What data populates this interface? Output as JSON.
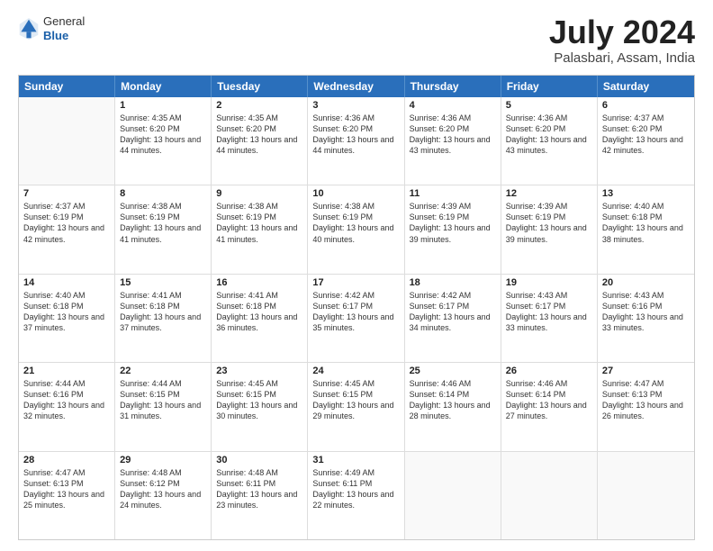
{
  "logo": {
    "general": "General",
    "blue": "Blue"
  },
  "title": "July 2024",
  "location": "Palasbari, Assam, India",
  "header_days": [
    "Sunday",
    "Monday",
    "Tuesday",
    "Wednesday",
    "Thursday",
    "Friday",
    "Saturday"
  ],
  "weeks": [
    [
      {
        "day": "",
        "sunrise": "",
        "sunset": "",
        "daylight": ""
      },
      {
        "day": "1",
        "sunrise": "Sunrise: 4:35 AM",
        "sunset": "Sunset: 6:20 PM",
        "daylight": "Daylight: 13 hours and 44 minutes."
      },
      {
        "day": "2",
        "sunrise": "Sunrise: 4:35 AM",
        "sunset": "Sunset: 6:20 PM",
        "daylight": "Daylight: 13 hours and 44 minutes."
      },
      {
        "day": "3",
        "sunrise": "Sunrise: 4:36 AM",
        "sunset": "Sunset: 6:20 PM",
        "daylight": "Daylight: 13 hours and 44 minutes."
      },
      {
        "day": "4",
        "sunrise": "Sunrise: 4:36 AM",
        "sunset": "Sunset: 6:20 PM",
        "daylight": "Daylight: 13 hours and 43 minutes."
      },
      {
        "day": "5",
        "sunrise": "Sunrise: 4:36 AM",
        "sunset": "Sunset: 6:20 PM",
        "daylight": "Daylight: 13 hours and 43 minutes."
      },
      {
        "day": "6",
        "sunrise": "Sunrise: 4:37 AM",
        "sunset": "Sunset: 6:20 PM",
        "daylight": "Daylight: 13 hours and 42 minutes."
      }
    ],
    [
      {
        "day": "7",
        "sunrise": "Sunrise: 4:37 AM",
        "sunset": "Sunset: 6:19 PM",
        "daylight": "Daylight: 13 hours and 42 minutes."
      },
      {
        "day": "8",
        "sunrise": "Sunrise: 4:38 AM",
        "sunset": "Sunset: 6:19 PM",
        "daylight": "Daylight: 13 hours and 41 minutes."
      },
      {
        "day": "9",
        "sunrise": "Sunrise: 4:38 AM",
        "sunset": "Sunset: 6:19 PM",
        "daylight": "Daylight: 13 hours and 41 minutes."
      },
      {
        "day": "10",
        "sunrise": "Sunrise: 4:38 AM",
        "sunset": "Sunset: 6:19 PM",
        "daylight": "Daylight: 13 hours and 40 minutes."
      },
      {
        "day": "11",
        "sunrise": "Sunrise: 4:39 AM",
        "sunset": "Sunset: 6:19 PM",
        "daylight": "Daylight: 13 hours and 39 minutes."
      },
      {
        "day": "12",
        "sunrise": "Sunrise: 4:39 AM",
        "sunset": "Sunset: 6:19 PM",
        "daylight": "Daylight: 13 hours and 39 minutes."
      },
      {
        "day": "13",
        "sunrise": "Sunrise: 4:40 AM",
        "sunset": "Sunset: 6:18 PM",
        "daylight": "Daylight: 13 hours and 38 minutes."
      }
    ],
    [
      {
        "day": "14",
        "sunrise": "Sunrise: 4:40 AM",
        "sunset": "Sunset: 6:18 PM",
        "daylight": "Daylight: 13 hours and 37 minutes."
      },
      {
        "day": "15",
        "sunrise": "Sunrise: 4:41 AM",
        "sunset": "Sunset: 6:18 PM",
        "daylight": "Daylight: 13 hours and 37 minutes."
      },
      {
        "day": "16",
        "sunrise": "Sunrise: 4:41 AM",
        "sunset": "Sunset: 6:18 PM",
        "daylight": "Daylight: 13 hours and 36 minutes."
      },
      {
        "day": "17",
        "sunrise": "Sunrise: 4:42 AM",
        "sunset": "Sunset: 6:17 PM",
        "daylight": "Daylight: 13 hours and 35 minutes."
      },
      {
        "day": "18",
        "sunrise": "Sunrise: 4:42 AM",
        "sunset": "Sunset: 6:17 PM",
        "daylight": "Daylight: 13 hours and 34 minutes."
      },
      {
        "day": "19",
        "sunrise": "Sunrise: 4:43 AM",
        "sunset": "Sunset: 6:17 PM",
        "daylight": "Daylight: 13 hours and 33 minutes."
      },
      {
        "day": "20",
        "sunrise": "Sunrise: 4:43 AM",
        "sunset": "Sunset: 6:16 PM",
        "daylight": "Daylight: 13 hours and 33 minutes."
      }
    ],
    [
      {
        "day": "21",
        "sunrise": "Sunrise: 4:44 AM",
        "sunset": "Sunset: 6:16 PM",
        "daylight": "Daylight: 13 hours and 32 minutes."
      },
      {
        "day": "22",
        "sunrise": "Sunrise: 4:44 AM",
        "sunset": "Sunset: 6:15 PM",
        "daylight": "Daylight: 13 hours and 31 minutes."
      },
      {
        "day": "23",
        "sunrise": "Sunrise: 4:45 AM",
        "sunset": "Sunset: 6:15 PM",
        "daylight": "Daylight: 13 hours and 30 minutes."
      },
      {
        "day": "24",
        "sunrise": "Sunrise: 4:45 AM",
        "sunset": "Sunset: 6:15 PM",
        "daylight": "Daylight: 13 hours and 29 minutes."
      },
      {
        "day": "25",
        "sunrise": "Sunrise: 4:46 AM",
        "sunset": "Sunset: 6:14 PM",
        "daylight": "Daylight: 13 hours and 28 minutes."
      },
      {
        "day": "26",
        "sunrise": "Sunrise: 4:46 AM",
        "sunset": "Sunset: 6:14 PM",
        "daylight": "Daylight: 13 hours and 27 minutes."
      },
      {
        "day": "27",
        "sunrise": "Sunrise: 4:47 AM",
        "sunset": "Sunset: 6:13 PM",
        "daylight": "Daylight: 13 hours and 26 minutes."
      }
    ],
    [
      {
        "day": "28",
        "sunrise": "Sunrise: 4:47 AM",
        "sunset": "Sunset: 6:13 PM",
        "daylight": "Daylight: 13 hours and 25 minutes."
      },
      {
        "day": "29",
        "sunrise": "Sunrise: 4:48 AM",
        "sunset": "Sunset: 6:12 PM",
        "daylight": "Daylight: 13 hours and 24 minutes."
      },
      {
        "day": "30",
        "sunrise": "Sunrise: 4:48 AM",
        "sunset": "Sunset: 6:11 PM",
        "daylight": "Daylight: 13 hours and 23 minutes."
      },
      {
        "day": "31",
        "sunrise": "Sunrise: 4:49 AM",
        "sunset": "Sunset: 6:11 PM",
        "daylight": "Daylight: 13 hours and 22 minutes."
      },
      {
        "day": "",
        "sunrise": "",
        "sunset": "",
        "daylight": ""
      },
      {
        "day": "",
        "sunrise": "",
        "sunset": "",
        "daylight": ""
      },
      {
        "day": "",
        "sunrise": "",
        "sunset": "",
        "daylight": ""
      }
    ]
  ]
}
